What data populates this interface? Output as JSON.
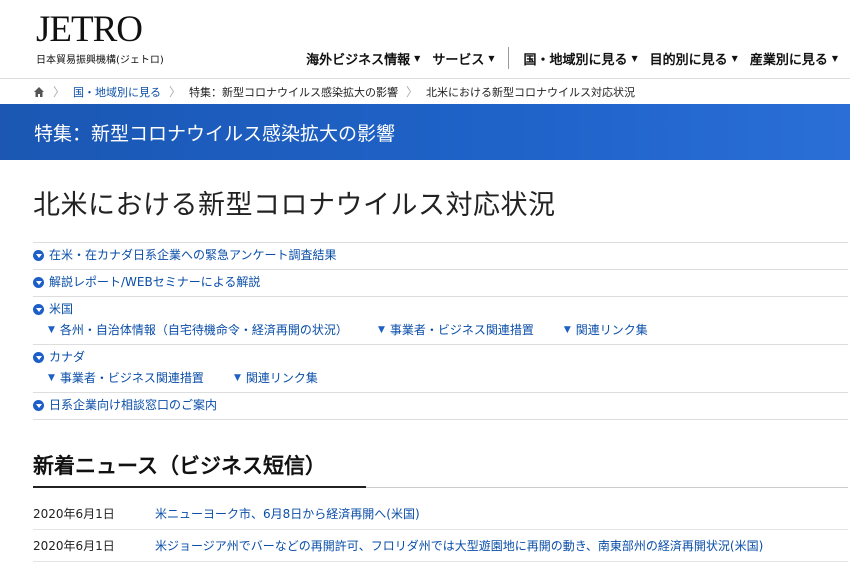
{
  "header": {
    "logo_text": "JETRO",
    "logo_subtitle": "日本貿易振興機構(ジェトロ)",
    "nav": [
      {
        "label": "海外ビジネス情報"
      },
      {
        "label": "サービス"
      },
      {
        "label": "国・地域別に見る"
      },
      {
        "label": "目的別に見る"
      },
      {
        "label": "産業別に見る"
      }
    ]
  },
  "breadcrumb": {
    "items": [
      {
        "label": "国・地域別に見る"
      },
      {
        "label": "特集：新型コロナウイルス感染拡大の影響"
      }
    ],
    "current": "北米における新型コロナウイルス対応状況"
  },
  "banner": {
    "title": "特集：新型コロナウイルス感染拡大の影響"
  },
  "page": {
    "title": "北米における新型コロナウイルス対応状況"
  },
  "toc": {
    "survey": "在米・在カナダ日系企業への緊急アンケート調査結果",
    "report": "解説レポート/WEBセミナーによる解説",
    "us": {
      "label": "米国",
      "subs": [
        {
          "label": "各州・自治体情報（自宅待機命令・経済再開の状況）"
        },
        {
          "label": "事業者・ビジネス関連措置"
        },
        {
          "label": "関連リンク集"
        }
      ]
    },
    "canada": {
      "label": "カナダ",
      "subs": [
        {
          "label": "事業者・ビジネス関連措置"
        },
        {
          "label": "関連リンク集"
        }
      ]
    },
    "consult": "日系企業向け相談窓口のご案内"
  },
  "news": {
    "title": "新着ニュース（ビジネス短信）",
    "items": [
      {
        "date": "2020年6月1日",
        "title": "米ニューヨーク市、6月8日から経済再開へ(米国)"
      },
      {
        "date": "2020年6月1日",
        "title": "米ジョージア州でバーなどの再開許可、フロリダ州では大型遊園地に再開の動き、南東部州の経済再開状況(米国)"
      }
    ]
  },
  "colors": {
    "banner": "#1f63c9",
    "link": "#0a4ea8"
  }
}
